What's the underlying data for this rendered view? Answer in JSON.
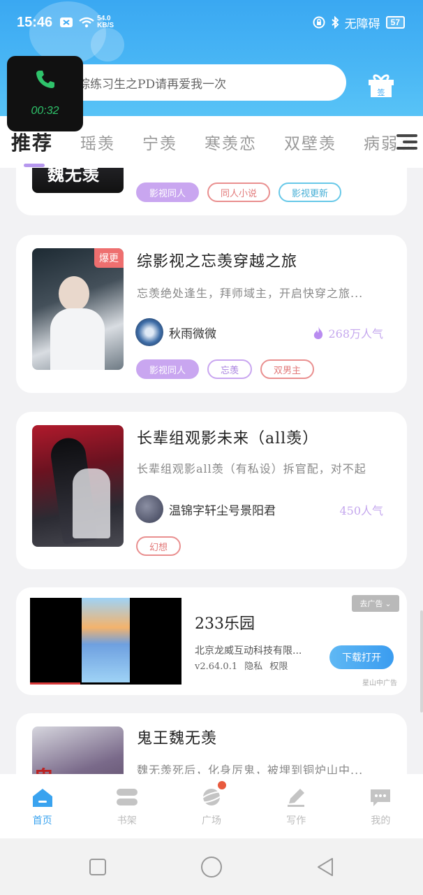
{
  "status_bar": {
    "time": "15:46",
    "net_speed_value": "54.0",
    "net_speed_unit": "KB/S",
    "accessibility_label": "无障碍",
    "battery": "57"
  },
  "call_overlay": {
    "duration": "00:32"
  },
  "search": {
    "placeholder": "综练习生之PD请再爱我一次"
  },
  "gift": {
    "label": "签"
  },
  "tabs": [
    "推荐",
    "瑶羡",
    "宁羡",
    "寒羡恋",
    "双壁羡",
    "病弱羡"
  ],
  "card0": {
    "cover_text": "魏无羡",
    "tags": [
      "影视同人",
      "同人小说",
      "影视更新"
    ]
  },
  "card1": {
    "badge": "爆更",
    "title": "综影视之忘羡穿越之旅",
    "desc": "忘羡绝处逢生，拜师域主，开启快穿之旅...",
    "author": "秋雨微微",
    "popularity": "268万人气",
    "tags": [
      "影视同人",
      "忘羡",
      "双男主"
    ]
  },
  "card2": {
    "title": "长辈组观影未来（all羡）",
    "desc": "长辈组观影all羡（有私设）拆官配，对不起",
    "author": "温锦字轩尘号景阳君",
    "popularity": "450人气",
    "tags": [
      "幻想"
    ]
  },
  "ad": {
    "title": "233乐园",
    "company": "北京龙威互动科技有限...",
    "version": "v2.64.0.1",
    "privacy": "隐私",
    "permissions": "权限",
    "button": "下载打开",
    "close_label": "去广告",
    "source": "星山中广告"
  },
  "card3": {
    "title": "鬼王魏无羡",
    "desc": "魏无羡死后，化身厉鬼，被埋到铜炉山中..."
  },
  "bottom_nav": [
    "首页",
    "书架",
    "广场",
    "写作",
    "我的"
  ],
  "colors": {
    "accent": "#3aa3ef",
    "tag_purple": "#c9a6f0",
    "badge_red": "#ee6f6f"
  }
}
